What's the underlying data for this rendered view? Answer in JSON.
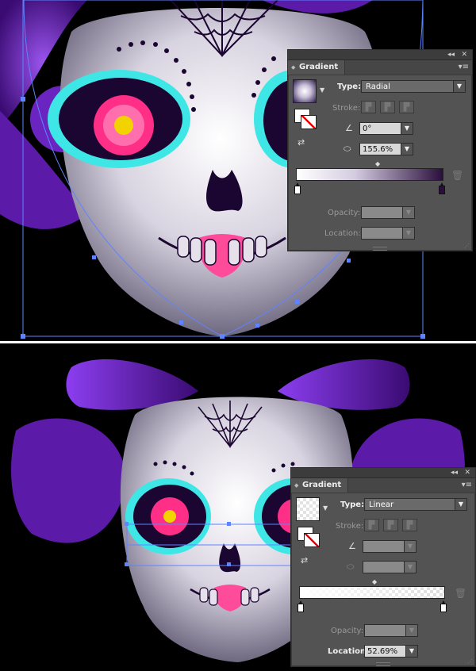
{
  "panels": [
    {
      "title": "Gradient",
      "type_label": "Type:",
      "type_value": "Radial",
      "stroke_label": "Stroke:",
      "angle_value": "0°",
      "aspect_value": "155.6%",
      "opacity_label": "Opacity:",
      "location_label": "Location:",
      "location_value": ""
    },
    {
      "title": "Gradient",
      "type_label": "Type:",
      "type_value": "Linear",
      "stroke_label": "Stroke:",
      "angle_value": "",
      "aspect_value": "",
      "opacity_label": "Opacity:",
      "location_label": "Location:",
      "location_value": "52.69%"
    }
  ],
  "glyphs": {
    "collapse": "◂◂",
    "close": "✕",
    "tab_grip": "◆",
    "menu": "▾≡",
    "dropdown": "▼",
    "reverse": "⇄",
    "angle": "∠",
    "aspect": "⬭",
    "midpoint": "◆",
    "trash": "🗑",
    "resize": "⋰"
  },
  "colors": {
    "face_highlight": "#ffffff",
    "face_shadow": "#6e6880",
    "hair_purple": "#7a2fd1",
    "eye_cyan": "#3ee6e6",
    "flower_pink": "#ff2e87",
    "flower_center": "#f2d200",
    "eye_socket": "#1a0630",
    "selection_blue": "#5f84ff"
  }
}
